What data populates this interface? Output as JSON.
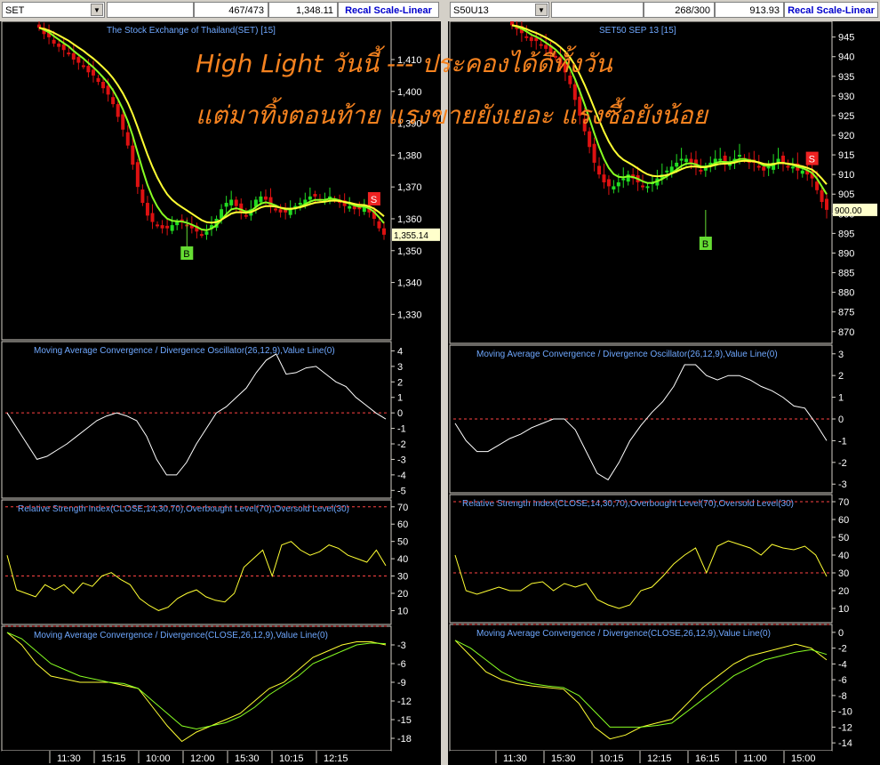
{
  "left": {
    "symbol": "SET",
    "count": "467/473",
    "price": "1,348.11",
    "recal": "Recal Scale-Linear",
    "title_main": "The Stock Exchange of Thailand(SET) [15]",
    "price_ticks": [
      "1,410",
      "1,400",
      "1,390",
      "1,380",
      "1,370",
      "1,360",
      "1,350",
      "1,340",
      "1,330"
    ],
    "last_label": "1,355.14",
    "macd_title": "Moving Average Convergence / Divergence Oscillator(26,12,9),Value Line(0)",
    "macd_ticks": [
      "4",
      "3",
      "2",
      "1",
      "0",
      "-1",
      "-2",
      "-3",
      "-4",
      "-5"
    ],
    "rsi_title": "Relative Strength Index(CLOSE,14,30,70),Overbought Level(70),Oversold Level(30)",
    "rsi_ticks": [
      "70",
      "60",
      "50",
      "40",
      "30",
      "20",
      "10"
    ],
    "macd2_title": "Moving Average Convergence / Divergence(CLOSE,26,12,9),Value Line(0)",
    "macd2_ticks": [
      "-3",
      "-6",
      "-9",
      "-12",
      "-15",
      "-18"
    ],
    "time_labels": [
      "11:30",
      "15:15",
      "10:00",
      "12:00",
      "15:30",
      "10:15",
      "12:15"
    ]
  },
  "right": {
    "symbol": "S50U13",
    "count": "268/300",
    "price": "913.93",
    "recal": "Recal Scale-Linear",
    "title_main": "SET50 SEP 13   [15]",
    "price_ticks": [
      "945",
      "940",
      "935",
      "930",
      "925",
      "920",
      "915",
      "910",
      "905",
      "900",
      "895",
      "890",
      "885",
      "880",
      "875",
      "870"
    ],
    "last_label": "900.00",
    "macd_title": "Moving Average Convergence / Divergence Oscillator(26,12,9),Value Line(0)",
    "macd_ticks": [
      "3",
      "2",
      "1",
      "0",
      "-1",
      "-2",
      "-3"
    ],
    "rsi_title": "Relative Strength Index(CLOSE,14,30,70),Overbought Level(70),Oversold Level(30)",
    "rsi_ticks": [
      "70",
      "60",
      "50",
      "40",
      "30",
      "20",
      "10"
    ],
    "macd2_title": "Moving Average Convergence / Divergence(CLOSE,26,12,9),Value Line(0)",
    "macd2_ticks": [
      "0",
      "-2",
      "-4",
      "-6",
      "-8",
      "-10",
      "-12",
      "-14"
    ],
    "time_labels": [
      "11:30",
      "15:30",
      "10:15",
      "12:15",
      "16:15",
      "11:00",
      "15:00"
    ]
  },
  "headline": {
    "line1": "High Light วันนี้ --- ประคองได้ดีทั้งวัน",
    "line2": "แต่มาทิ้งตอนท้าย แรงขายยังเยอะ แรงซื้อยังน้อย"
  },
  "colors": {
    "up": "#22dd22",
    "down": "#dd1111",
    "ema_fast": "#88ff22",
    "ema_slow": "#ffff33",
    "label": "#6fa8ff",
    "zero": "#ff4444",
    "buy": "#66dd33",
    "sell": "#ee2222"
  },
  "signals": {
    "buy": "B",
    "sell": "S"
  },
  "chart_data": [
    {
      "type": "candlestick",
      "title": "The Stock Exchange of Thailand(SET) [15]",
      "ylim": [
        1322,
        1422
      ],
      "close": [
        1420,
        1418,
        1417,
        1415,
        1414,
        1413,
        1412,
        1410,
        1409,
        1408,
        1406,
        1405,
        1403,
        1401,
        1399,
        1396,
        1392,
        1388,
        1383,
        1377,
        1370,
        1365,
        1361,
        1359,
        1358,
        1357,
        1357,
        1358,
        1359,
        1359,
        1358,
        1357,
        1356,
        1355,
        1356,
        1358,
        1360,
        1363,
        1365,
        1366,
        1364,
        1362,
        1361,
        1363,
        1366,
        1367,
        1366,
        1364,
        1363,
        1362,
        1362,
        1363,
        1364,
        1365,
        1366,
        1367,
        1367,
        1366,
        1366,
        1367,
        1366,
        1365,
        1364,
        1364,
        1363,
        1363,
        1364,
        1362,
        1360,
        1357,
        1355
      ]
    },
    {
      "type": "candlestick",
      "title": "SET50 SEP 13   [15]",
      "ylim": [
        867,
        949
      ],
      "close": [
        948,
        947,
        946,
        945,
        944,
        944,
        943,
        942,
        941,
        940,
        938,
        936,
        933,
        929,
        925,
        921,
        917,
        913,
        910,
        908,
        907,
        907,
        908,
        909,
        910,
        909,
        908,
        907,
        907,
        908,
        909,
        910,
        911,
        912,
        913,
        914,
        914,
        913,
        912,
        911,
        912,
        913,
        914,
        914,
        913,
        913,
        914,
        915,
        914,
        913,
        913,
        912,
        911,
        912,
        913,
        914,
        913,
        912,
        912,
        911,
        911,
        910,
        909,
        906,
        903,
        901
      ]
    },
    {
      "type": "line",
      "title": "Moving Average Convergence / Divergence Oscillator(26,12,9),Value Line(0)",
      "ylim": [
        -5.5,
        4.6
      ],
      "values": [
        0,
        -1,
        -2,
        -3,
        -2.8,
        -2.4,
        -2.0,
        -1.5,
        -1.0,
        -0.5,
        -0.2,
        0,
        -0.2,
        -0.5,
        -1.5,
        -3,
        -4,
        -4,
        -3.2,
        -2,
        -1,
        0,
        0.4,
        1,
        1.6,
        2.6,
        3.4,
        3.8,
        2.5,
        2.6,
        2.9,
        3.0,
        2.5,
        2.0,
        1.7,
        1.0,
        0.5,
        0,
        -0.4
      ]
    },
    {
      "type": "line",
      "title": "Moving Average Convergence / Divergence Oscillator(26,12,9),Value Line(0)",
      "ylim": [
        -3.4,
        3.4
      ],
      "values": [
        -0.2,
        -1,
        -1.5,
        -1.5,
        -1.2,
        -0.9,
        -0.7,
        -0.4,
        -0.2,
        0,
        0,
        -0.5,
        -1.5,
        -2.5,
        -2.8,
        -2,
        -1,
        -0.3,
        0.3,
        0.8,
        1.5,
        2.5,
        2.5,
        2.0,
        1.8,
        2.0,
        2.0,
        1.8,
        1.5,
        1.3,
        1.0,
        0.6,
        0.5,
        -0.2,
        -1
      ]
    },
    {
      "type": "line",
      "title": "Relative Strength Index(CLOSE,14,30,70),Overbought Level(70),Oversold Level(30)",
      "ylim": [
        2,
        74
      ],
      "values": [
        42,
        22,
        20,
        18,
        25,
        22,
        25,
        20,
        26,
        24,
        30,
        32,
        28,
        25,
        17,
        13,
        10,
        12,
        17,
        20,
        22,
        18,
        16,
        15,
        20,
        35,
        40,
        45,
        30,
        48,
        50,
        45,
        42,
        44,
        48,
        46,
        42,
        40,
        38,
        45,
        36
      ]
    },
    {
      "type": "line",
      "title": "Relative Strength Index(CLOSE,14,30,70),Overbought Level(70),Oversold Level(30)",
      "ylim": [
        2,
        74
      ],
      "values": [
        40,
        20,
        18,
        20,
        22,
        20,
        20,
        24,
        25,
        20,
        24,
        22,
        24,
        15,
        12,
        10,
        12,
        20,
        22,
        28,
        35,
        40,
        44,
        30,
        45,
        48,
        46,
        44,
        40,
        46,
        44,
        43,
        45,
        40,
        28
      ]
    },
    {
      "type": "line",
      "title": "Moving Average Convergence / Divergence(CLOSE,26,12,9),Value Line(0)",
      "ylim": [
        -20,
        0
      ],
      "series": [
        {
          "values": [
            -1,
            -3,
            -6,
            -8,
            -8.5,
            -9,
            -9,
            -9,
            -9.5,
            -10,
            -13,
            -16,
            -18.5,
            -17,
            -16,
            -15,
            -14,
            -12,
            -10,
            -9,
            -7,
            -5,
            -4,
            -3,
            -2.5,
            -2.5,
            -3
          ]
        },
        {
          "values": [
            -1,
            -2,
            -4,
            -6,
            -7,
            -8,
            -8.5,
            -9,
            -9.2,
            -10,
            -12,
            -14,
            -16,
            -16.5,
            -16,
            -15.5,
            -14.5,
            -13,
            -11,
            -9.5,
            -8,
            -6,
            -5,
            -4,
            -3,
            -2.7,
            -2.8
          ]
        }
      ]
    },
    {
      "type": "line",
      "title": "Moving Average Convergence / Divergence(CLOSE,26,12,9),Value Line(0)",
      "ylim": [
        -15,
        1
      ],
      "series": [
        {
          "values": [
            -1,
            -3,
            -5,
            -6,
            -6.5,
            -6.8,
            -7,
            -7.2,
            -9,
            -12,
            -13.5,
            -13,
            -12,
            -11.5,
            -11,
            -9,
            -7,
            -5.5,
            -4,
            -3,
            -2.5,
            -2,
            -1.5,
            -2,
            -3.5
          ]
        },
        {
          "values": [
            -1,
            -2,
            -3.5,
            -5,
            -6,
            -6.5,
            -6.8,
            -7,
            -8,
            -10,
            -12,
            -12,
            -12,
            -11.8,
            -11.5,
            -10,
            -8.5,
            -7,
            -5.5,
            -4.5,
            -3.5,
            -3,
            -2.5,
            -2.2,
            -2.8
          ]
        }
      ]
    }
  ]
}
